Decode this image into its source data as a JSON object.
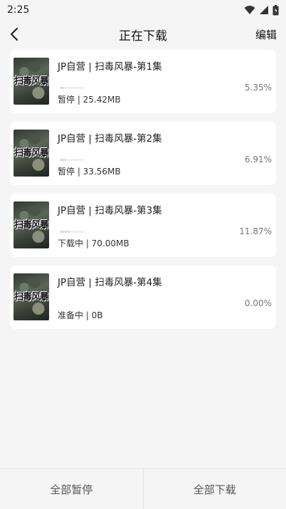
{
  "status_bar": {
    "time": "2:25"
  },
  "header": {
    "title": "正在下载",
    "edit_label": "编辑"
  },
  "downloads": [
    {
      "title": "JP自营 | 扫毒风暴-第1集",
      "status": "暂停 | 25.42MB",
      "percent": "5.35%",
      "progress": 0.0535,
      "thumb_text": "扫毒风暴"
    },
    {
      "title": "JP自营 | 扫毒风暴-第2集",
      "status": "暂停 | 33.56MB",
      "percent": "6.91%",
      "progress": 0.0691,
      "thumb_text": "扫毒风暴"
    },
    {
      "title": "JP自营 | 扫毒风暴-第3集",
      "status": "下载中 | 70.00MB",
      "percent": "11.87%",
      "progress": 0.1187,
      "thumb_text": "扫毒风暴"
    },
    {
      "title": "JP自营 | 扫毒风暴-第4集",
      "status": "准备中 | 0B",
      "percent": "0.00%",
      "progress": 0.0,
      "thumb_text": "扫毒风暴"
    }
  ],
  "footer": {
    "pause_all": "全部暂停",
    "download_all": "全部下载"
  },
  "icons": {
    "wifi": "wifi-icon",
    "signal": "signal-icon",
    "battery": "battery-icon",
    "back": "back-arrow-icon"
  }
}
